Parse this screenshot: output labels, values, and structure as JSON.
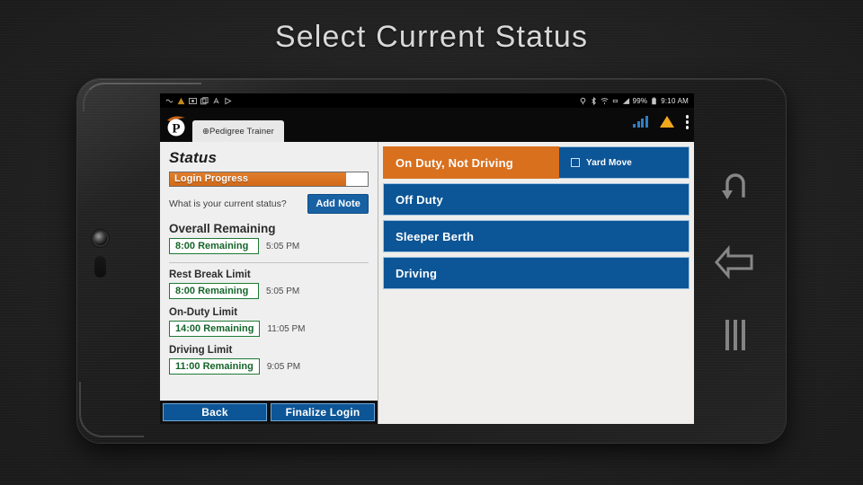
{
  "slide": {
    "title": "Select Current Status"
  },
  "device": {
    "camera_icon": "camera-lens",
    "home_button_icon": "home-pill"
  },
  "status_bar": {
    "left_icons": [
      "notification-icon",
      "warning-icon",
      "screenshot-icon",
      "copy-icon",
      "usb-debug-icon",
      "play-icon"
    ],
    "right_icons": [
      "location-icon",
      "bluetooth-icon",
      "wifi-icon",
      "vibrate-icon",
      "signal-icon"
    ],
    "battery_percent": "99%",
    "battery_icon": "battery-icon",
    "time": "9:10 AM"
  },
  "app_bar": {
    "logo_icon": "pedigree-p-logo",
    "logo_letter": "P",
    "tab_label": "⊕Pedigree Trainer",
    "signal_icon": "signal-bars-icon",
    "warning_icon": "warning-triangle-icon",
    "overflow_icon": "overflow-menu-icon"
  },
  "status_panel": {
    "heading": "Status",
    "login_progress": {
      "label": "Login Progress",
      "percent": 89
    },
    "current_status_question": "What is your current status?",
    "add_note_label": "Add Note",
    "limits": [
      {
        "label": "Overall Remaining",
        "value": "8:00 Remaining",
        "time": "5:05 PM"
      },
      {
        "label": "Rest Break Limit",
        "value": "8:00 Remaining",
        "time": "5:05 PM"
      },
      {
        "label": "On-Duty Limit",
        "value": "14:00 Remaining",
        "time": "11:05 PM"
      },
      {
        "label": "Driving Limit",
        "value": "11:00 Remaining",
        "time": "9:05 PM"
      }
    ],
    "footer_buttons": [
      {
        "label": "Back"
      },
      {
        "label": "Finalize Login"
      }
    ]
  },
  "duty_panel": {
    "options": [
      {
        "label": "On Duty, Not Driving",
        "selected": true
      },
      {
        "label": "Off Duty",
        "selected": false
      },
      {
        "label": "Sleeper Berth",
        "selected": false
      },
      {
        "label": "Driving",
        "selected": false
      }
    ],
    "yard_move": {
      "label": "Yard Move",
      "checked": false
    }
  },
  "nav_bar": {
    "items": [
      {
        "icon": "undo-arrow-icon"
      },
      {
        "icon": "back-arrow-icon"
      },
      {
        "icon": "recent-apps-icon"
      }
    ]
  },
  "colors": {
    "accent_orange": "#d9701e",
    "accent_blue": "#0c5596",
    "button_blue": "#1862a4",
    "limit_green": "#14652a",
    "background": "#232323",
    "warning_yellow": "#f0a81e"
  }
}
